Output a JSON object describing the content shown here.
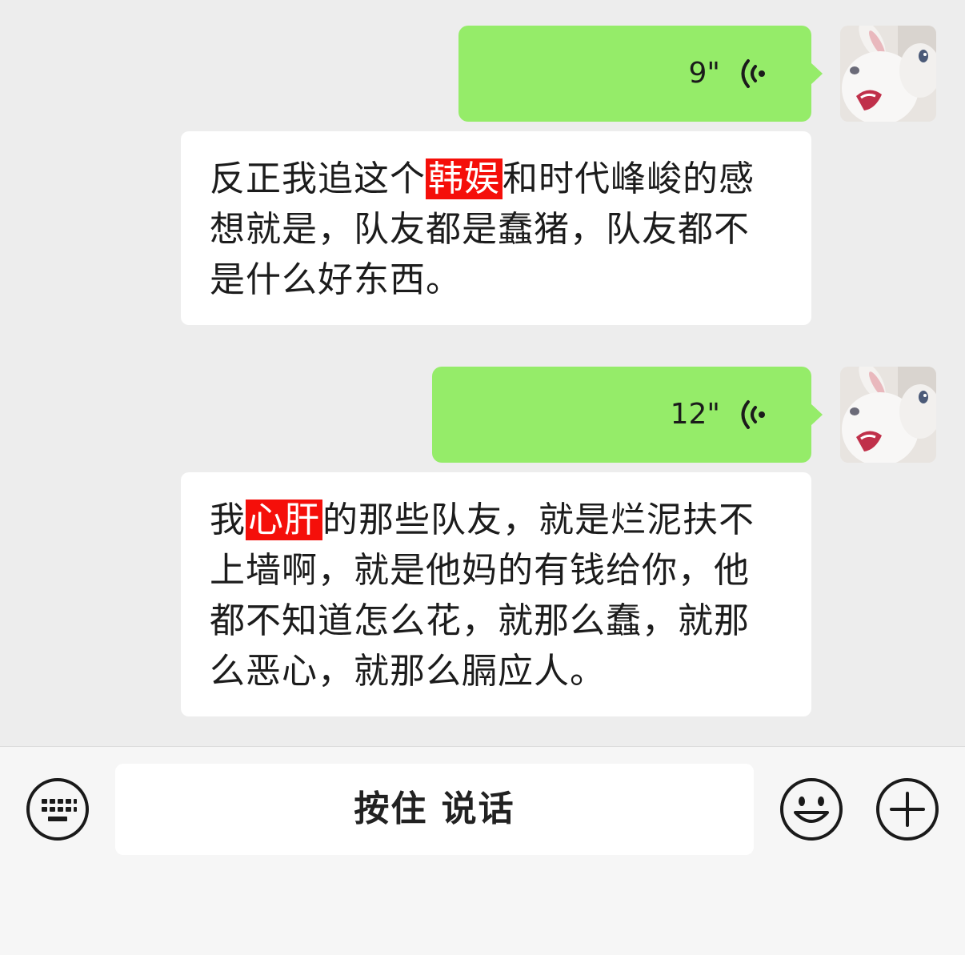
{
  "messages": [
    {
      "type": "voice",
      "duration": "9\"",
      "transcript_parts": [
        "反正我追这个",
        "韩娱",
        "和时代峰峻的感想就是，队友都是蠢猪，队友都不是什么好东西。"
      ]
    },
    {
      "type": "voice",
      "duration": "12\"",
      "transcript_parts": [
        "我",
        "心肝",
        "的那些队友，就是烂泥扶不上墙啊，就是他妈的有钱给你，他都不知道怎么花，就那么蠢，就那么恶心，就那么膈应人。"
      ]
    }
  ],
  "input_bar": {
    "hold_to_talk_label": "按住 说话",
    "keyboard_icon": "keyboard-icon",
    "emoji_icon": "emoji-icon",
    "add_icon": "add-icon"
  },
  "colors": {
    "background": "#ededed",
    "outgoing_bubble": "#95ec69",
    "transcript_bubble": "#ffffff",
    "highlight": "#f50f0a",
    "input_bar": "#f6f6f6"
  }
}
